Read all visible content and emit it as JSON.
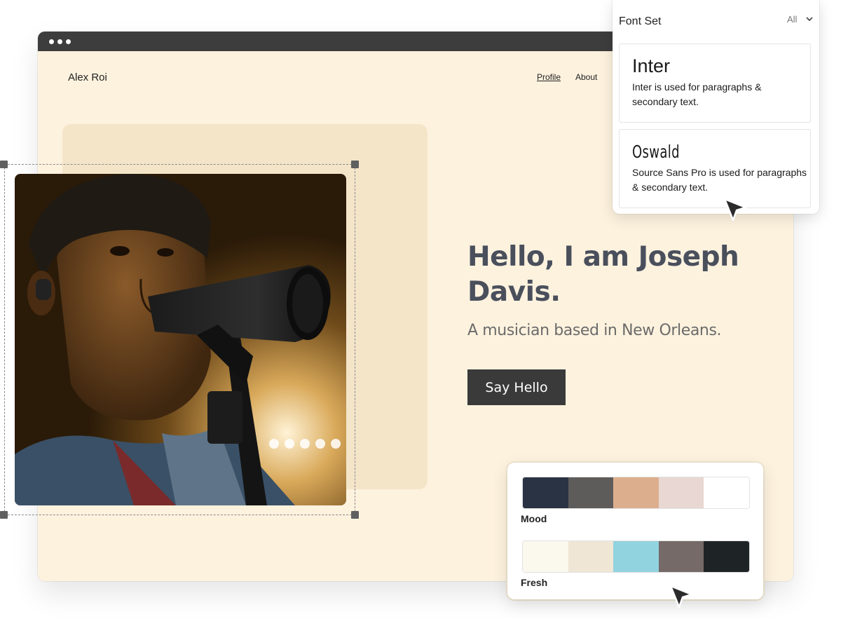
{
  "site": {
    "name": "Alex Roi",
    "nav": [
      "Profile",
      "About"
    ]
  },
  "hero": {
    "title": "Hello, I am Joseph Davis.",
    "subtitle": "A musician based in New Orleans.",
    "cta_label": "Say Hello"
  },
  "font_panel": {
    "title": "Font Set",
    "filter": "All",
    "fonts": [
      {
        "name": "Inter",
        "description": "Inter is used for paragraphs & secondary text."
      },
      {
        "name": "Oswald",
        "description": "Source Sans Pro is used for paragraphs & secondary text."
      }
    ]
  },
  "palettes": [
    {
      "name": "Mood",
      "colors": [
        "#293343",
        "#5e5c5b",
        "#dcae8d",
        "#e8d7d2",
        "#ffffff"
      ]
    },
    {
      "name": "Fresh",
      "colors": [
        "#fbf8ee",
        "#efe6d6",
        "#91d3df",
        "#756a68",
        "#1e2326"
      ]
    }
  ],
  "icons": {
    "window_dots": "three-dots-icon",
    "filter_chevron": "chevron-down-icon",
    "pointer": "pointer-cursor-icon"
  },
  "colors": {
    "page_bg": "#fdf2de",
    "card_bg": "#f4e5c9",
    "cta_bg": "#3a3a3a",
    "heading": "#4a4f5c"
  }
}
